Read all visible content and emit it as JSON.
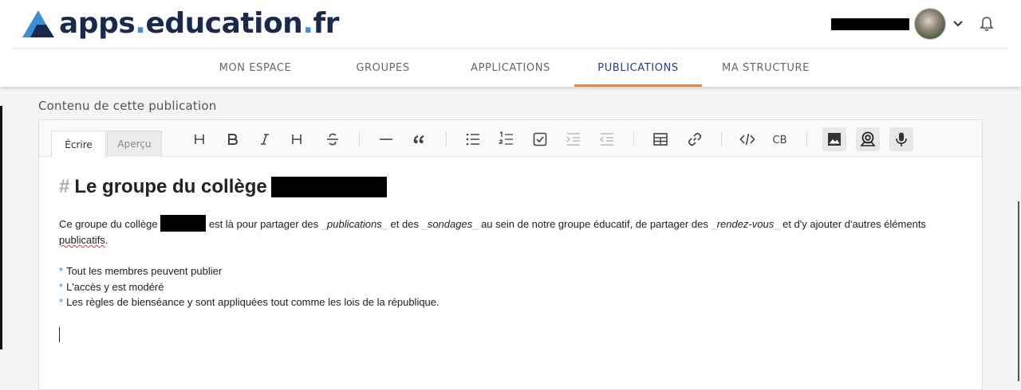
{
  "header": {
    "logo": {
      "text_main": "apps",
      "dot1": ".",
      "text_mid": "education",
      "dot2": ".",
      "text_end": "fr"
    }
  },
  "nav": {
    "tabs": [
      {
        "label": "MON ESPACE",
        "active": false
      },
      {
        "label": "GROUPES",
        "active": false
      },
      {
        "label": "APPLICATIONS",
        "active": false
      },
      {
        "label": "PUBLICATIONS",
        "active": true
      },
      {
        "label": "MA STRUCTURE",
        "active": false
      }
    ]
  },
  "editor": {
    "section_label": "Contenu de cette publication",
    "mode_tabs": {
      "write": "Écrire",
      "preview": "Aperçu"
    },
    "content": {
      "heading_hash": "#",
      "heading": "Le groupe du collège",
      "para": {
        "p1": "Ce groupe du collège",
        "p2": "est là pour partager des",
        "u1": "_",
        "em1": "publications",
        "u2": "_",
        "p3": "et des",
        "em2": "sondages",
        "p4": "au sein de notre groupe éducatif, de partager des",
        "em3": "rendez-vous",
        "p5": "et d'y ajouter d'autres éléments",
        "p6": "publicatifs",
        "p7": "."
      },
      "list_marker": "*",
      "list": [
        "Tout les membres peuvent publier",
        "L'accès y est modéré",
        "Les règles de bienséance y sont appliquées tout comme les lois de la république."
      ]
    }
  },
  "colors": {
    "brand_navy": "#1a2a4f",
    "brand_blue": "#3b8fd6",
    "active_tab": "#1d3f93",
    "tab_underline": "#e08a4a"
  }
}
